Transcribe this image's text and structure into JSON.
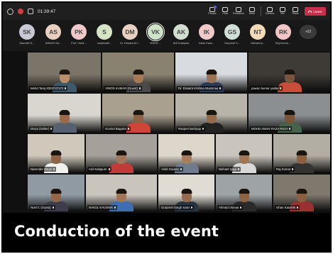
{
  "topbar": {
    "timer": "01:39:47",
    "controls": [
      {
        "label": "People",
        "icon": "people-icon"
      },
      {
        "label": "Chat",
        "icon": "chat-icon"
      },
      {
        "label": "Reactions",
        "icon": "reactions-icon"
      },
      {
        "label": "More",
        "icon": "more-icon"
      },
      {
        "label": "Camera",
        "icon": "camera-icon"
      },
      {
        "label": "Mic",
        "icon": "mic-icon"
      },
      {
        "label": "Share",
        "icon": "share-icon"
      }
    ],
    "leave_label": "Leave",
    "colors": {
      "leave": "#c4314b",
      "accent": "#5b5fc7"
    }
  },
  "avatars": [
    {
      "initials": "SK",
      "name": "Saurabh K...",
      "color": "#c9c9d6"
    },
    {
      "initials": "AS",
      "name": "ANKUR SA...",
      "color": "#e8cfc0"
    },
    {
      "initials": "PK",
      "name": "Prof. Vivek...",
      "color": "#efc9c9"
    },
    {
      "initials": "S",
      "name": "sanjhinahi...",
      "color": "#d6e3c7"
    },
    {
      "initials": "DM",
      "name": "Dr. Eswara Kri...",
      "color": "#e8d0c2"
    },
    {
      "initials": "VK",
      "name": "VINOD ...",
      "color": "#cfe3c9",
      "selected": true
    },
    {
      "initials": "AK",
      "name": "Anil Kalapure",
      "color": "#d2dcd0"
    },
    {
      "initials": "IK",
      "name": "Ishan Kaus...",
      "color": "#f0c9c9"
    },
    {
      "initials": "GS",
      "name": "Gurpreet S...",
      "color": "#cfe0d8"
    },
    {
      "initials": "NT",
      "name": "Nishant ty...",
      "color": "#f2d9b8"
    },
    {
      "initials": "RK",
      "name": "Raj Kumar ...",
      "color": "#f3c6c6"
    }
  ],
  "more_count": "+52",
  "tiles": [
    {
      "name": "Mohd Tariq 8303747172"
    },
    {
      "name": "VINOD KUMAR (Guest)"
    },
    {
      "name": "Dr. Eswara Krishna Mussinaa"
    },
    {
      "name": "pawan kumar yadav"
    },
    {
      "name": "Divya (Saber)"
    },
    {
      "name": "Govind Bagaria"
    },
    {
      "name": "Ranjeet kashyap"
    },
    {
      "name": "MOHD AMAN RAZA RIZVI"
    },
    {
      "name": "Narender Singh"
    },
    {
      "name": "Anil Kalapure"
    },
    {
      "name": "Ankit Gaurav"
    },
    {
      "name": "Nishant tyagi"
    },
    {
      "name": "Raj Kumar"
    },
    {
      "name": "Noel C (Guest)"
    },
    {
      "name": "NAKUL KAUSHIK"
    },
    {
      "name": "Gurpreet Singh Saini"
    },
    {
      "name": "Ahmad Usman"
    },
    {
      "name": "Ishan Kaushik"
    }
  ],
  "caption": "Conduction of the event"
}
